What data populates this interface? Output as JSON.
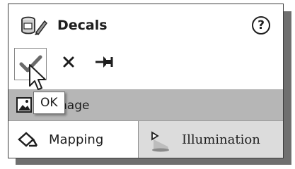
{
  "panel": {
    "title": "Decals",
    "help_glyph": "?"
  },
  "toolbar": {
    "ok_tooltip": "OK"
  },
  "image_section": {
    "label": "nage"
  },
  "tabs": [
    {
      "label": "Mapping",
      "active": true
    },
    {
      "label": "Illumination",
      "active": false
    }
  ],
  "icons": {
    "title": "decals-icon",
    "help": "help-icon",
    "ok": "checkmark-icon",
    "cancel": "close-icon",
    "pin": "pushpin-icon",
    "image": "image-icon",
    "mapping": "mapping-icon",
    "illumination": "illumination-icon"
  }
}
